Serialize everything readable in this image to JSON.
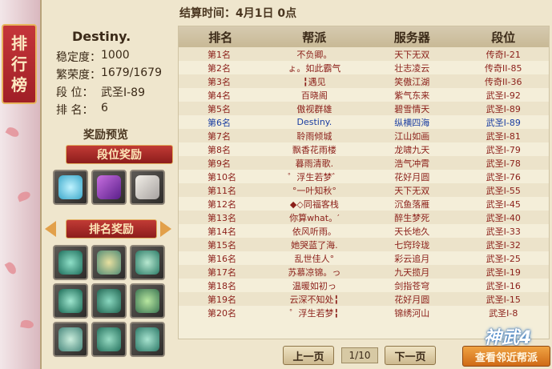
{
  "sidebar": {
    "chars": [
      "排",
      "行",
      "榜"
    ]
  },
  "settle_time": "结算时间：4月1日  0点",
  "player": {
    "name": "Destiny.",
    "rows": [
      {
        "label": "稳定度：",
        "value": "1000"
      },
      {
        "label": "繁荣度：",
        "value": "1679/1679"
      },
      {
        "label": "段  位：",
        "value": "武圣I-89"
      },
      {
        "label": "排  名：",
        "value": "6"
      }
    ]
  },
  "rewards": {
    "preview_title": "奖励预览",
    "tier_button": "段位奖励",
    "rank_button": "排名奖励",
    "tier_icons": [
      "dragon-icon",
      "book-icon",
      "scroll-icon"
    ],
    "rank_icons": [
      "jade-ship-icon",
      "jade-palace-icon",
      "jade-island-icon",
      "jade-bridge-icon",
      "jade-temple-icon",
      "jade-pavilion-icon",
      "jade-arch-icon",
      "jade-ruins-icon",
      "jade-ring-icon"
    ]
  },
  "table": {
    "headers": [
      "排名",
      "帮派",
      "服务器",
      "段位"
    ],
    "rows": [
      [
        "第1名",
        "不负卿。",
        "天下无双",
        "传奇I-21"
      ],
      [
        "第2名",
        "ょ。如此霸气",
        "壮志凌云",
        "传奇II-85"
      ],
      [
        "第3名",
        "╏遇见",
        "笑傲江湖",
        "传奇II-36"
      ],
      [
        "第4名",
        "百晓阁",
        "紫气东来",
        "武圣I-92"
      ],
      [
        "第5名",
        "傲视群雄",
        "碧雪情天",
        "武圣I-89"
      ],
      [
        "第6名",
        "Destiny.",
        "纵横四海",
        "武圣I-89"
      ],
      [
        "第7名",
        "聆雨倾城",
        "江山如画",
        "武圣I-81"
      ],
      [
        "第8名",
        "飘香花雨楼",
        "龙啸九天",
        "武圣I-79"
      ],
      [
        "第9名",
        "暮雨清歌.",
        "浩气冲霄",
        "武圣I-78"
      ],
      [
        "第10名",
        "゜浮生若梦゛",
        "花好月圆",
        "武圣I-76"
      ],
      [
        "第11名",
        "°一叶知秋°",
        "天下无双",
        "武圣I-55"
      ],
      [
        "第12名",
        "◆◇同福客栈",
        "沉鱼落雁",
        "武圣I-45"
      ],
      [
        "第13名",
        "你算what。′",
        "醉生梦死",
        "武圣I-40"
      ],
      [
        "第14名",
        "依风听雨。",
        "天长地久",
        "武圣I-33"
      ],
      [
        "第15名",
        "她哭蓝了海.",
        "七窍玲珑",
        "武圣I-32"
      ],
      [
        "第16名",
        "乱世佳人°",
        "彩云追月",
        "武圣I-25"
      ],
      [
        "第17名",
        "苏慕凉锦。っ",
        "九天揽月",
        "武圣I-19"
      ],
      [
        "第18名",
        "温暖如初っ",
        "剑指苍穹",
        "武圣I-16"
      ],
      [
        "第19名",
        "云深不知处╏",
        "花好月圆",
        "武圣I-15"
      ],
      [
        "第20名",
        "゜浮生若梦╏",
        "锦绣河山",
        "武圣I-8"
      ]
    ],
    "highlight_index": 5
  },
  "pagination": {
    "prev": "上一页",
    "page": "1/10",
    "next": "下一页"
  },
  "near_button": "查看邻近帮派",
  "logo": "神武4",
  "colors": {
    "row_text": "#8b1f19",
    "highlight_text": "#1b3ea2",
    "banner_red": "#c5353a"
  }
}
